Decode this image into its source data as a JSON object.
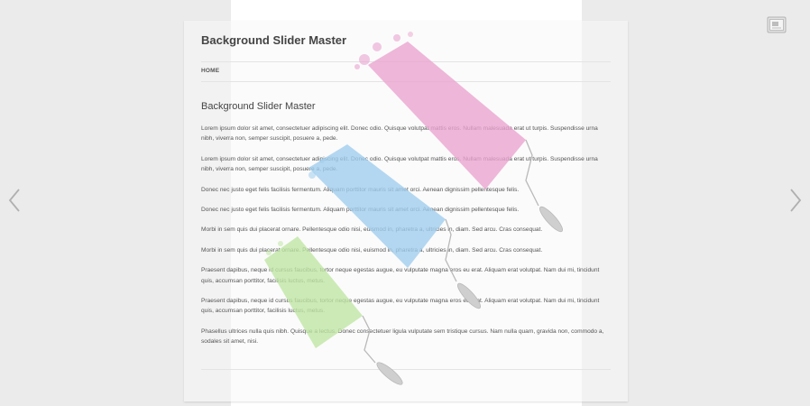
{
  "site": {
    "title": "Background Slider Master"
  },
  "nav": {
    "items": [
      {
        "label": "HOME"
      }
    ]
  },
  "entry": {
    "title": "Background Slider Master",
    "paragraphs": [
      "Lorem ipsum dolor sit amet, consectetuer adipiscing elit. Donec odio. Quisque volutpat mattis eros. Nullam malesuada erat ut turpis. Suspendisse urna nibh, viverra non, semper suscipit, posuere a, pede.",
      "Lorem ipsum dolor sit amet, consectetuer adipiscing elit. Donec odio. Quisque volutpat mattis eros. Nullam malesuada erat ut turpis. Suspendisse urna nibh, viverra non, semper suscipit, posuere a, pede.",
      "Donec nec justo eget felis facilisis fermentum. Aliquam porttitor mauris sit amet orci. Aenean dignissim pellentesque felis.",
      "Donec nec justo eget felis facilisis fermentum. Aliquam porttitor mauris sit amet orci. Aenean dignissim pellentesque felis.",
      "Morbi in sem quis dui placerat ornare. Pellentesque odio nisi, euismod in, pharetra a, ultricies in, diam. Sed arcu. Cras consequat.",
      "Morbi in sem quis dui placerat ornare. Pellentesque odio nisi, euismod in, pharetra a, ultricies in, diam. Sed arcu. Cras consequat.",
      "Praesent dapibus, neque id cursus faucibus, tortor neque egestas augue, eu vulputate magna eros eu erat. Aliquam erat volutpat. Nam dui mi, tincidunt quis, accumsan porttitor, facilisis luctus, metus.",
      "Praesent dapibus, neque id cursus faucibus, tortor neque egestas augue, eu vulputate magna eros eu erat. Aliquam erat volutpat. Nam dui mi, tincidunt quis, accumsan porttitor, facilisis luctus, metus.",
      "Phasellus ultrices nulla quis nibh. Quisque a lectus. Donec consectetuer ligula vulputate sem tristique cursus. Nam nulla quam, gravida non, commodo a, sodales sit amet, nisi."
    ]
  },
  "slider": {
    "prev_icon": "chevron-left-icon",
    "next_icon": "chevron-right-icon",
    "fullscreen_icon": "fullscreen-icon"
  },
  "colors": {
    "pink": "#eaa3d0",
    "blue": "#9fcdee",
    "green": "#bfe5a3",
    "handle": "#b9b9b9",
    "text": "#555555",
    "title": "#444444",
    "page_bg": "#ebebeb"
  }
}
